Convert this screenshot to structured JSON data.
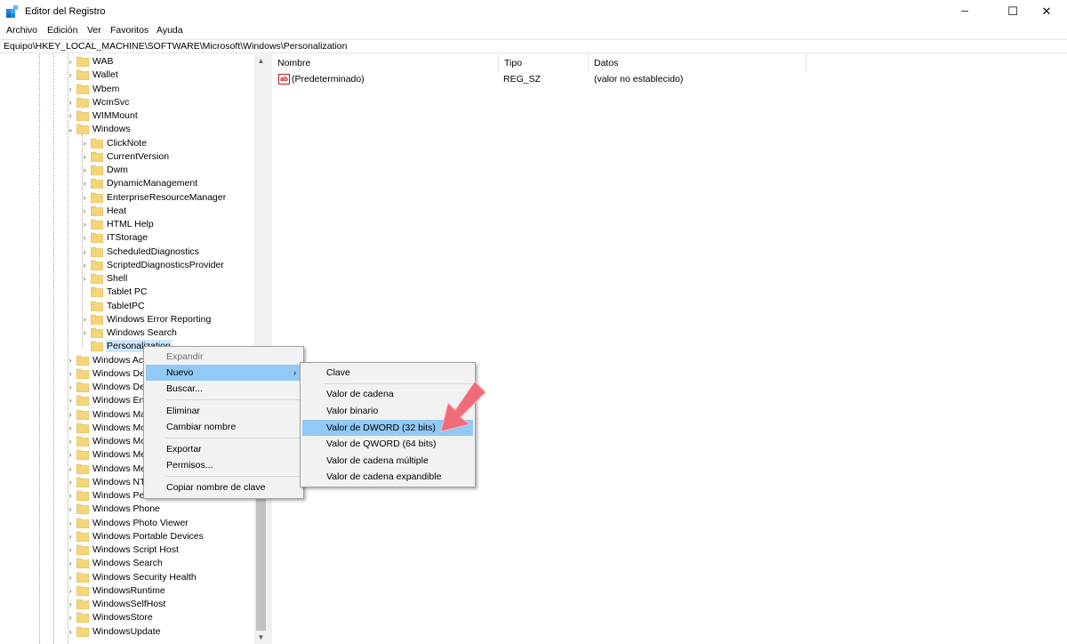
{
  "window": {
    "title": "Editor del Registro",
    "minimize_glyph": "─",
    "maximize_glyph": "☐",
    "close_glyph": "✕"
  },
  "menubar": {
    "items": [
      "Archivo",
      "Edición",
      "Ver",
      "Favoritos",
      "Ayuda"
    ]
  },
  "address": {
    "path": "Equipo\\HKEY_LOCAL_MACHINE\\SOFTWARE\\Microsoft\\Windows\\Personalization"
  },
  "tree": {
    "level1": [
      "WAB",
      "Wallet",
      "Wbem",
      "WcmSvc",
      "WIMMount",
      "Windows"
    ],
    "windows_children": [
      "ClickNote",
      "CurrentVersion",
      "Dwm",
      "DynamicManagement",
      "EnterpriseResourceManager",
      "Heat",
      "HTML Help",
      "ITStorage",
      "ScheduledDiagnostics",
      "ScriptedDiagnosticsProvider",
      "Shell",
      "Tablet PC",
      "TabletPC",
      "Windows Error Reporting",
      "Windows Search",
      "Personalization"
    ],
    "after_windows": [
      "Windows Ac",
      "Windows De",
      "Windows De",
      "Windows En",
      "Windows Ma",
      "Windows Mo",
      "Windows Mo",
      "Windows Me",
      "Windows Me",
      "Windows NT",
      "Windows Pe",
      "Windows Phone",
      "Windows Photo Viewer",
      "Windows Portable Devices",
      "Windows Script Host",
      "Windows Search",
      "Windows Security Health",
      "WindowsRuntime",
      "WindowsSelfHost",
      "WindowsStore",
      "WindowsUpdate"
    ],
    "selected": "Personalization"
  },
  "list": {
    "headers": [
      "Nombre",
      "Tipo",
      "Datos"
    ],
    "rows": [
      {
        "name": "(Predeterminado)",
        "type": "REG_SZ",
        "data": "(valor no establecido)",
        "icon": "ab"
      }
    ]
  },
  "context_menu": {
    "items": [
      "Expandir",
      "Nuevo",
      "Buscar...",
      "Eliminar",
      "Cambiar nombre",
      "Exportar",
      "Permisos...",
      "Copiar nombre de clave"
    ],
    "disabled": "Expandir",
    "highlighted": "Nuevo",
    "submenu_glyph": "›"
  },
  "submenu": {
    "items": [
      "Clave",
      "Valor de cadena",
      "Valor binario",
      "Valor de DWORD (32 bits)",
      "Valor de QWORD (64 bits)",
      "Valor de cadena múltiple",
      "Valor de cadena expandible"
    ],
    "highlighted": "Valor de DWORD (32 bits)"
  },
  "colors": {
    "folder": "#f5d57a",
    "selection": "#cce8ff",
    "menu_highlight": "#91c9f7",
    "annotation_arrow": "#f26b78"
  },
  "icons": {
    "scroll_up": "▲",
    "scroll_down": "▼",
    "collapsed": "›",
    "expanded": "⌄"
  }
}
